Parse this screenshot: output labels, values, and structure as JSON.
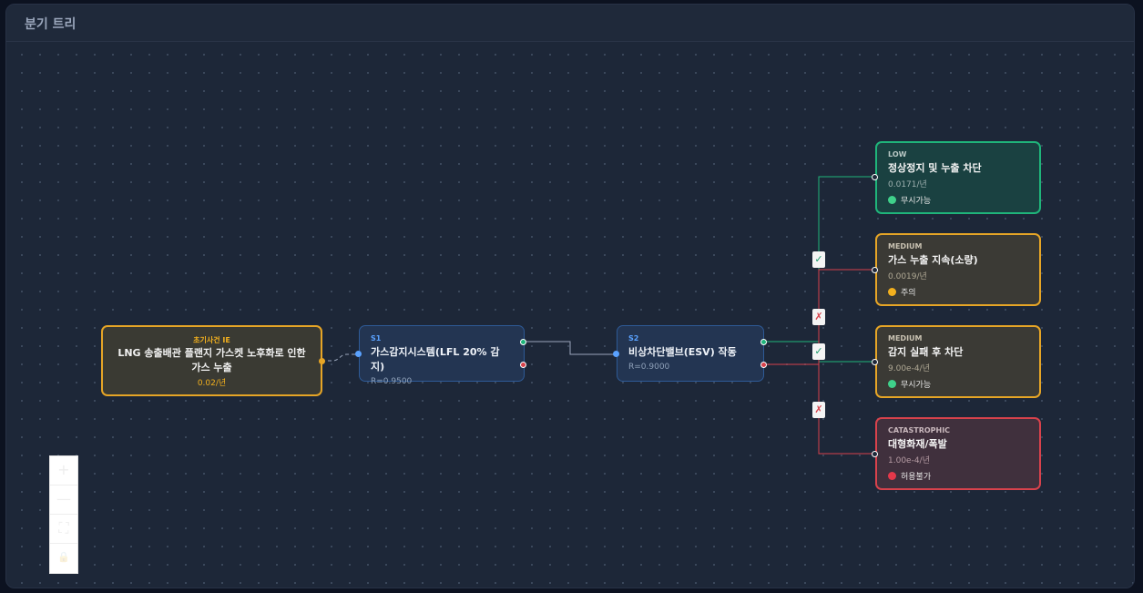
{
  "panel": {
    "title": "분기 트리"
  },
  "initiating_event": {
    "tag": "초기사건 IE",
    "title": "LNG 송출배관 플랜지 가스켓 노후화로 인한 가스 누출",
    "frequency": "0.02/년"
  },
  "systems": [
    {
      "id": "S1",
      "title": "가스감지시스템(LFL 20% 감지)",
      "reliability": "R=0.9500"
    },
    {
      "id": "S2",
      "title": "비상차단밸브(ESV) 작동",
      "reliability": "R=0.9000"
    }
  ],
  "branch_badges": {
    "success": "✓",
    "failure": "✗"
  },
  "outcomes": [
    {
      "level": "LOW",
      "title": "정상정지 및 누출 차단",
      "frequency": "0.0171/년",
      "status": "무시가능",
      "status_color": "#3fd18a"
    },
    {
      "level": "MEDIUM",
      "title": "가스 누출 지속(소량)",
      "frequency": "0.0019/년",
      "status": "주의",
      "status_color": "#f2b01e"
    },
    {
      "level": "MEDIUM",
      "title": "감지 실패 후 차단",
      "frequency": "9.00e-4/년",
      "status": "무시가능",
      "status_color": "#3fd18a"
    },
    {
      "level": "CATASTROPHIC",
      "title": "대형화재/폭발",
      "frequency": "1.00e-4/년",
      "status": "허용불가",
      "status_color": "#e5384a"
    }
  ],
  "colors": {
    "success": "#1fb47a",
    "failure": "#d8424c",
    "ie": "#e6a526",
    "system": "#2e5a96"
  },
  "controls": [
    {
      "name": "zoom-in-icon",
      "glyph": "+"
    },
    {
      "name": "zoom-out-icon",
      "glyph": "—"
    },
    {
      "name": "fit-view-icon",
      "glyph": "⛶"
    },
    {
      "name": "lock-icon",
      "glyph": "🔒"
    }
  ]
}
